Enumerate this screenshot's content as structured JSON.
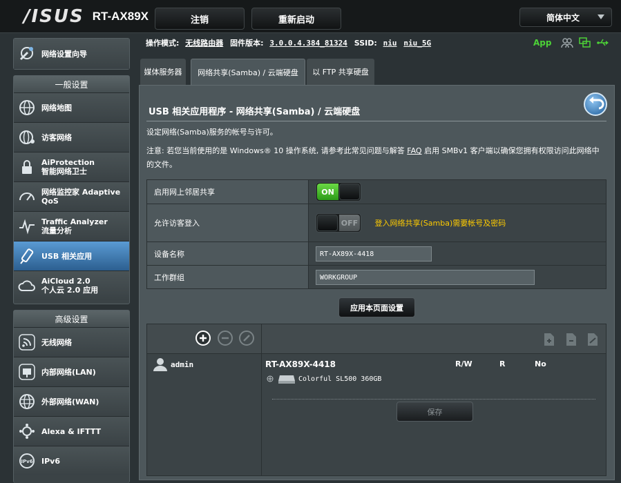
{
  "header": {
    "brand": "/ISUS",
    "model": "RT-AX89X",
    "logout_label": "注销",
    "reboot_label": "重新启动",
    "language": "简体中文"
  },
  "status": {
    "mode_label": "操作模式:",
    "mode_value": "无线路由器",
    "firmware_label": "固件版本:",
    "firmware_value": "3.0.0.4.384_81324",
    "ssid_label": "SSID:",
    "ssid_1": "niu",
    "ssid_2": "niu_5G",
    "app_label": "App"
  },
  "sidebar": {
    "wizard": "网络设置向导",
    "general_header": "一般设置",
    "general": [
      {
        "label": "网络地图"
      },
      {
        "label": "访客网络"
      },
      {
        "label": "AiProtection\n智能网络卫士"
      },
      {
        "label": "网络监控家 Adaptive QoS"
      },
      {
        "label": "Traffic Analyzer\n流量分析"
      },
      {
        "label": "USB 相关应用"
      },
      {
        "label": "AiCloud 2.0\n个人云 2.0 应用"
      }
    ],
    "advanced_header": "高级设置",
    "advanced": [
      {
        "label": "无线网络"
      },
      {
        "label": "内部网络(LAN)"
      },
      {
        "label": "外部网络(WAN)"
      },
      {
        "label": "Alexa & IFTTT"
      },
      {
        "label": "IPv6"
      }
    ]
  },
  "tabs": [
    {
      "label": "媒体服务器"
    },
    {
      "label": "网络共享(Samba) / 云端硬盘"
    },
    {
      "label": "以 FTP 共享硬盘"
    }
  ],
  "main": {
    "title": "USB 相关应用程序 - 网络共享(Samba) / 云端硬盘",
    "desc": "设定网络(Samba)服务的帐号与许可。",
    "note_before": "注意: 若您当前使用的是 Windows® 10 操作系统, 请参考此常见问题与解答 ",
    "note_link": "FAQ",
    "note_after": " 启用 SMBv1 客户端以确保您拥有权限访问此网络中的文件。",
    "rows": {
      "share_label": "启用网上邻居共享",
      "on_text": "ON",
      "guest_label": "允许访客登入",
      "off_text": "OFF",
      "guest_hint": "登入网络共享(Samba)需要帐号及密码",
      "device_label": "设备名称",
      "device_value": "RT-AX89X-4418",
      "workgroup_label": "工作群组",
      "workgroup_value": "WORKGROUP"
    },
    "apply_label": "应用本页面设置",
    "perm": {
      "user": "admin",
      "device": "RT-AX89X-4418",
      "rw": "R/W",
      "r": "R",
      "no": "No",
      "disk": "Colorful SL500 360GB",
      "save_label": "保存"
    }
  },
  "colors": {
    "accent": "#2c5f90",
    "on_green": "#2c9a18",
    "hint": "#ffcc00"
  }
}
